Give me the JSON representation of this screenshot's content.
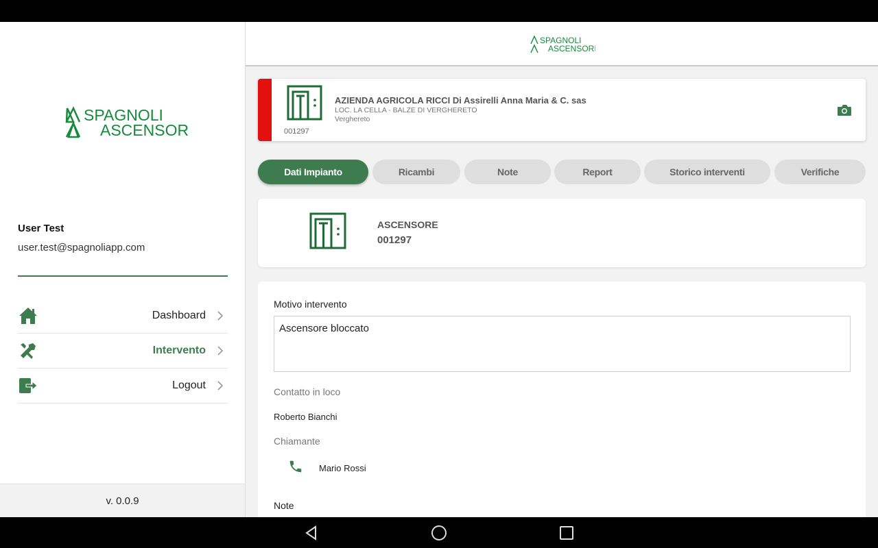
{
  "brand": {
    "line1": "SPAGNOLI",
    "line2": "ASCENSORI",
    "color": "#178a3c"
  },
  "sidebar": {
    "user_name": "User Test",
    "user_email": "user.test@spagnoliapp.com",
    "menu": [
      {
        "label": "Dashboard",
        "icon": "home-icon",
        "active": false
      },
      {
        "label": "Intervento",
        "icon": "tools-icon",
        "active": true
      },
      {
        "label": "Logout",
        "icon": "logout-icon",
        "active": false
      }
    ],
    "version": "v. 0.0.9"
  },
  "plant": {
    "company": "AZIENDA AGRICOLA RICCI Di Assirelli Anna Maria & C. sas",
    "address": "LOC. LA CELLA - BALZE DI VERGHERETO",
    "city": "Verghereto",
    "code": "001297",
    "status_color": "#e31010"
  },
  "tabs": [
    {
      "label": "Dati Impianto",
      "active": true
    },
    {
      "label": "Ricambi",
      "active": false
    },
    {
      "label": "Note",
      "active": false
    },
    {
      "label": "Report",
      "active": false
    },
    {
      "label": "Storico interventi",
      "active": false
    },
    {
      "label": "Verifiche",
      "active": false
    }
  ],
  "equipment": {
    "type": "ASCENSORE",
    "code": "001297"
  },
  "details": {
    "motivo_label": "Motivo intervento",
    "motivo_value": "Ascensore bloccato",
    "contatto_label": "Contatto in loco",
    "contatto_value": "Roberto Bianchi",
    "chiamante_label": "Chiamante",
    "chiamante_value": "Mario Rossi",
    "note_label": "Note"
  },
  "colors": {
    "accent": "#3e7c4f",
    "icon_green": "#1e6b35"
  }
}
